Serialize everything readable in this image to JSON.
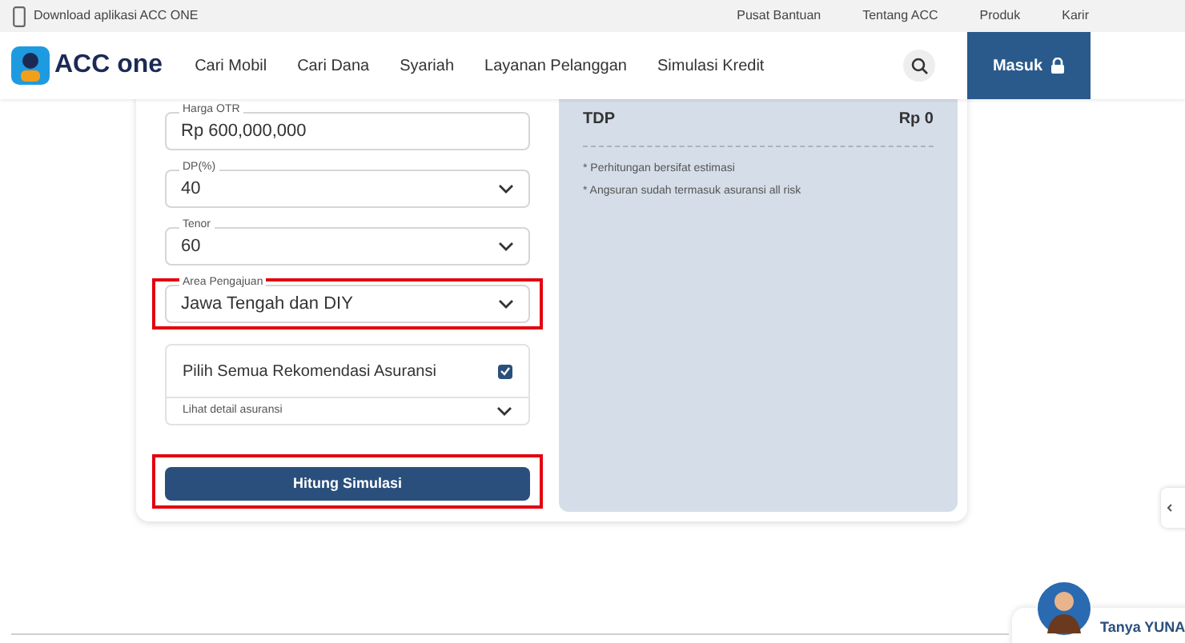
{
  "top_bar": {
    "download_text": "Download aplikasi ACC ONE",
    "links": [
      "Pusat Bantuan",
      "Tentang ACC",
      "Produk",
      "Karir"
    ]
  },
  "nav": {
    "logo_text": "ACC one",
    "items": [
      "Cari Mobil",
      "Cari Dana",
      "Syariah",
      "Layanan Pelanggan",
      "Simulasi Kredit"
    ],
    "login_button": "Masuk"
  },
  "form": {
    "fields": [
      {
        "kind": "input",
        "label": "Harga OTR",
        "value": "Rp 600,000,000",
        "highlighted": false
      },
      {
        "kind": "select",
        "label": "DP(%)",
        "value": "40",
        "highlighted": false
      },
      {
        "kind": "select",
        "label": "Tenor",
        "value": "60",
        "highlighted": false
      },
      {
        "kind": "select",
        "label": "Area Pengajuan",
        "value": "Jawa Tengah dan DIY",
        "highlighted": true
      }
    ],
    "insurance": {
      "label": "Pilih Semua Rekomendasi Asuransi",
      "checked": true,
      "detail": "Lihat detail asuransi"
    },
    "submit": {
      "label": "Hitung Simulasi",
      "highlighted": true
    }
  },
  "summary": {
    "rows": [
      {
        "label": "TDP",
        "value": "Rp 0"
      }
    ],
    "notes": [
      "* Perhitungan bersifat estimasi",
      "* Angsuran sudah termasuk asuransi all risk"
    ]
  },
  "chat": {
    "label": "Tanya YUNA"
  }
}
